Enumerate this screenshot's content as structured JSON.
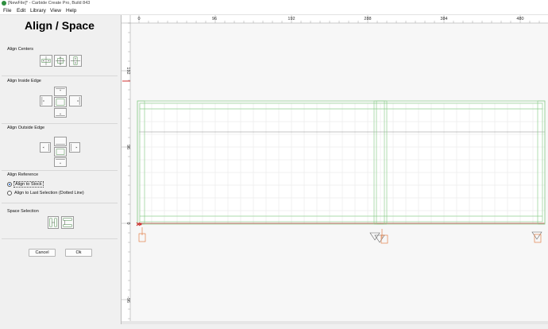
{
  "window": {
    "title": "[NewFile]* - Carbide Create Pro, Build 843"
  },
  "menu": {
    "file": "File",
    "edit": "Edit",
    "library": "Library",
    "view": "View",
    "help": "Help"
  },
  "panel": {
    "title": "Align / Space",
    "align_centers": "Align Centers",
    "align_inside_edge": "Align Inside Edge",
    "align_outside_edge": "Align Outside Edge",
    "align_reference": "Align Reference",
    "align_to_stock": "Align to Stock",
    "align_to_last_selection": "Align to Last Selection (Dotted Line)",
    "align_reference_selected": "Align to Stock",
    "space_selection": "Space Selection",
    "cancel": "Cancel",
    "ok": "Ok"
  },
  "canvas": {
    "ruler_x_labels": [
      "0",
      "96",
      "192",
      "288",
      "384",
      "480"
    ],
    "ruler_y_labels": [
      "192",
      "96",
      "0",
      "-96"
    ]
  },
  "colors": {
    "accent": "#1a5fc8",
    "origin_marker": "#d03030",
    "tool_marker": "#e07030",
    "shape_outline": "#8fcf8f",
    "grid": "#e3e3e3"
  }
}
